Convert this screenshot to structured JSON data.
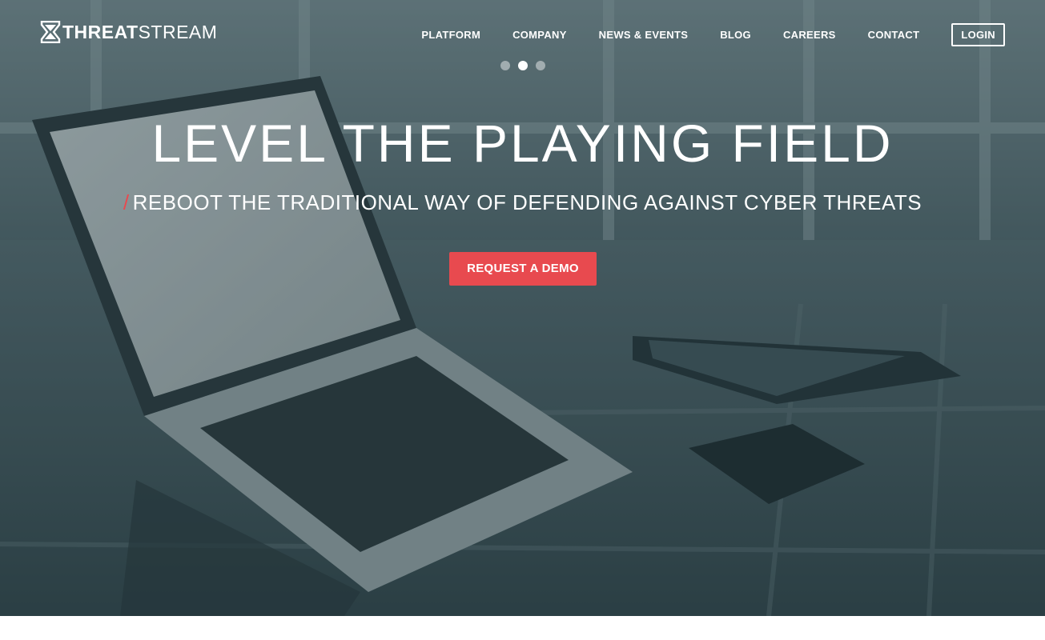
{
  "brand": {
    "name_bold": "THREAT",
    "name_light": "STREAM",
    "accent": "#e84a4f"
  },
  "nav": {
    "items": [
      {
        "label": "PLATFORM"
      },
      {
        "label": "COMPANY"
      },
      {
        "label": "NEWS & EVENTS"
      },
      {
        "label": "BLOG"
      },
      {
        "label": "CAREERS"
      },
      {
        "label": "CONTACT"
      }
    ],
    "login_label": "LOGIN"
  },
  "carousel": {
    "slide_count": 3,
    "active_index": 1
  },
  "hero": {
    "headline": "LEVEL THE PLAYING FIELD",
    "slash": "/",
    "subheadline": "REBOOT THE TRADITIONAL WAY OF DEFENDING AGAINST CYBER THREATS",
    "cta_label": "REQUEST A DEMO"
  }
}
